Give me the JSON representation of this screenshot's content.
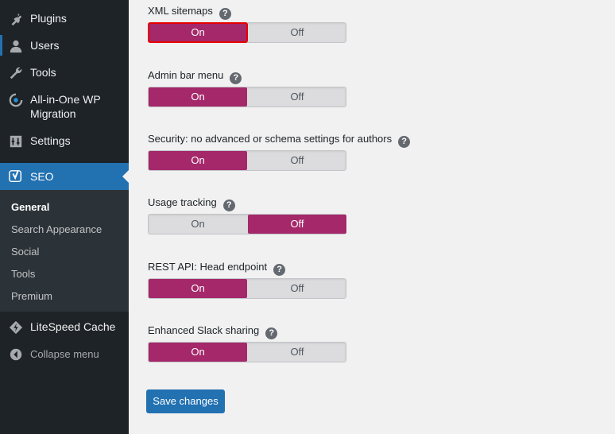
{
  "sidebar": {
    "items": [
      {
        "label": "Plugins",
        "icon": "plugin-icon"
      },
      {
        "label": "Users",
        "icon": "users-icon"
      },
      {
        "label": "Tools",
        "icon": "wrench-icon"
      },
      {
        "label_line1": "All-in-One WP",
        "label_line2": "Migration",
        "icon": "migration-icon"
      },
      {
        "label": "Settings",
        "icon": "settings-icon"
      },
      {
        "label": "SEO",
        "icon": "yoast-icon"
      },
      {
        "label": "LiteSpeed Cache",
        "icon": "litespeed-icon"
      },
      {
        "label": "Collapse menu",
        "icon": "collapse-icon"
      }
    ],
    "seo_submenu": [
      "General",
      "Search Appearance",
      "Social",
      "Tools",
      "Premium"
    ],
    "current_submenu": "General"
  },
  "help_glyph": "?",
  "settings": [
    {
      "label": "XML sitemaps",
      "on": "On",
      "off": "Off",
      "value": "on"
    },
    {
      "label": "Admin bar menu",
      "on": "On",
      "off": "Off",
      "value": "on"
    },
    {
      "label": "Security: no advanced or schema settings for authors",
      "on": "On",
      "off": "Off",
      "value": "on"
    },
    {
      "label": "Usage tracking",
      "on": "On",
      "off": "Off",
      "value": "off"
    },
    {
      "label": "REST API: Head endpoint",
      "on": "On",
      "off": "Off",
      "value": "on"
    },
    {
      "label": "Enhanced Slack sharing",
      "on": "On",
      "off": "Off",
      "value": "on"
    }
  ],
  "save_label": "Save changes",
  "colors": {
    "accent": "#a4286a",
    "admin_blue": "#2271b1",
    "sidebar_bg": "#1d2327",
    "highlight": "#e60000"
  }
}
